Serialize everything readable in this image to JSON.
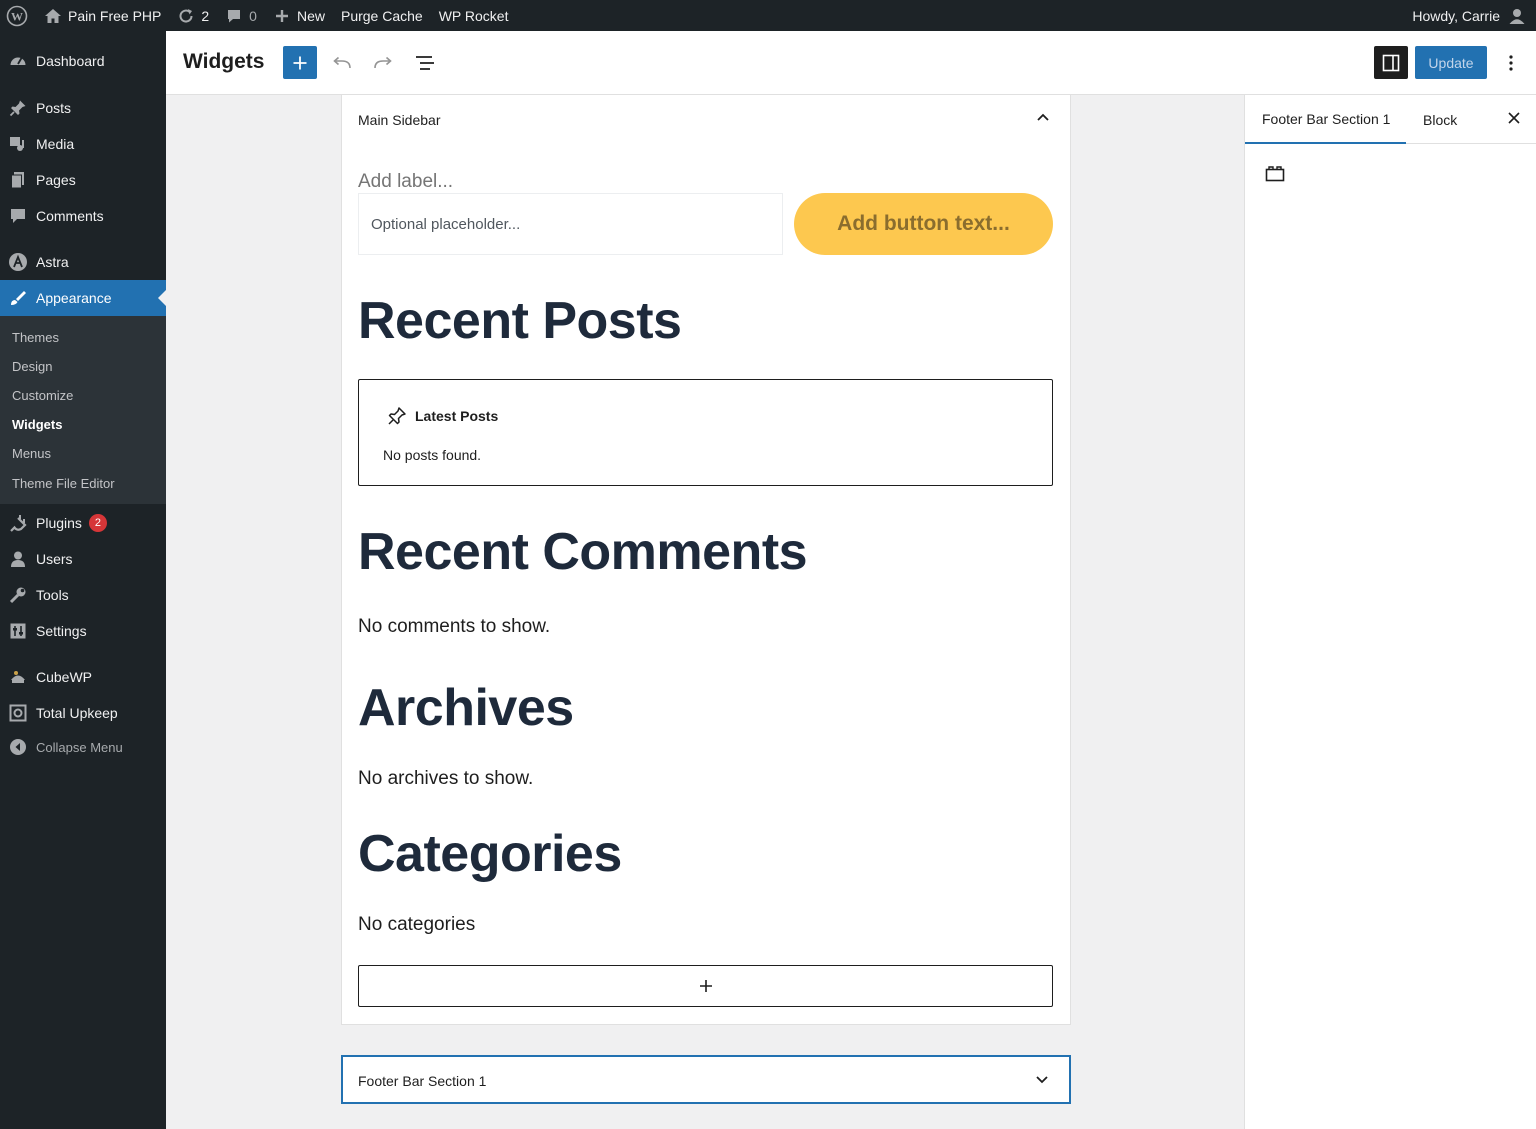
{
  "adminbar": {
    "site_name": "Pain Free PHP",
    "updates_count": "2",
    "comments_count": "0",
    "new_label": "New",
    "purge_cache": "Purge Cache",
    "wp_rocket": "WP Rocket",
    "howdy": "Howdy, Carrie"
  },
  "menu": {
    "dashboard": "Dashboard",
    "posts": "Posts",
    "media": "Media",
    "pages": "Pages",
    "comments": "Comments",
    "astra": "Astra",
    "appearance": "Appearance",
    "plugins": "Plugins",
    "plugins_badge": "2",
    "users": "Users",
    "tools": "Tools",
    "settings": "Settings",
    "cubewp": "CubeWP",
    "total_upkeep": "Total Upkeep",
    "collapse": "Collapse Menu"
  },
  "submenu": {
    "themes": "Themes",
    "design": "Design",
    "customize": "Customize",
    "widgets": "Widgets",
    "menus": "Menus",
    "theme_file_editor": "Theme File Editor"
  },
  "editor": {
    "title": "Widgets",
    "update_label": "Update"
  },
  "widget_area": {
    "title": "Main Sidebar",
    "search_label": "Add label...",
    "search_placeholder": "Optional placeholder...",
    "search_button": "Add button text...",
    "recent_posts_heading": "Recent Posts",
    "latest_posts_title": "Latest Posts",
    "latest_posts_empty": "No posts found.",
    "recent_comments_heading": "Recent Comments",
    "recent_comments_empty": "No comments to show.",
    "archives_heading": "Archives",
    "archives_empty": "No archives to show.",
    "categories_heading": "Categories",
    "categories_empty": "No categories"
  },
  "footer_area": {
    "title": "Footer Bar Section 1"
  },
  "sidebar": {
    "tab_area": "Footer Bar Section 1",
    "tab_block": "Block"
  },
  "colors": {
    "accent": "#2271b1",
    "admin_dark": "#1d2327",
    "search_button": "#fdc84f",
    "badge": "#d63638"
  }
}
